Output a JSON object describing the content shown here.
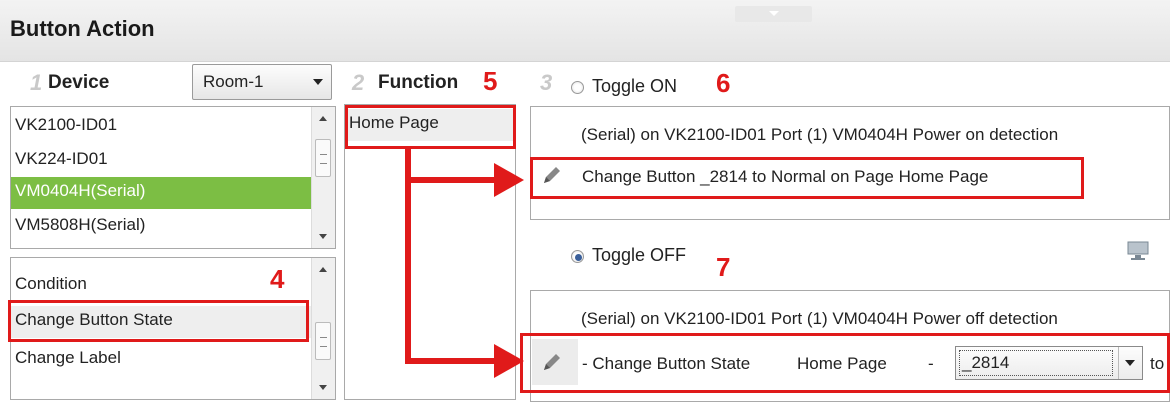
{
  "window": {
    "title": "Button Action"
  },
  "device": {
    "step": "1",
    "header": "Device",
    "room_select": "Room-1",
    "items": [
      {
        "label": "VK2100-ID01",
        "selected": false
      },
      {
        "label": "VK224-ID01",
        "selected": false
      },
      {
        "label": "VM0404H(Serial)",
        "selected": true
      },
      {
        "label": "VM5808H(Serial)",
        "selected": false
      }
    ],
    "highlight_color": "#7cbe44"
  },
  "commands": {
    "items": [
      {
        "label": "Condition"
      },
      {
        "label": "Change Button State"
      },
      {
        "label": "Change Label"
      }
    ],
    "annotation": "4"
  },
  "function": {
    "step": "2",
    "header": "Function",
    "annotation": "5",
    "items": [
      {
        "label": "Home Page"
      }
    ]
  },
  "toggle_on": {
    "step": "3",
    "label": "Toggle ON",
    "annotation": "6",
    "line1": "(Serial) on VK2100-ID01 Port (1) VM0404H Power on detection",
    "line2": "Change Button _2814 to Normal on Page Home Page"
  },
  "toggle_off": {
    "label": "Toggle OFF",
    "annotation": "7",
    "line1": "(Serial) on VK2100-ID01 Port (1) VM0404H Power off detection",
    "edit_prefix": "- Change Button State",
    "edit_page": "Home Page",
    "edit_dash": "-",
    "button_select": "_2814",
    "edit_suffix": "to"
  },
  "colors": {
    "annotation_red": "#e01a1a",
    "selected_radio": "#3a5f9a"
  },
  "icons": [
    "pencil-icon",
    "monitor-icon",
    "dropdown-arrow-icon",
    "scroll-up-icon",
    "scroll-down-icon"
  ]
}
